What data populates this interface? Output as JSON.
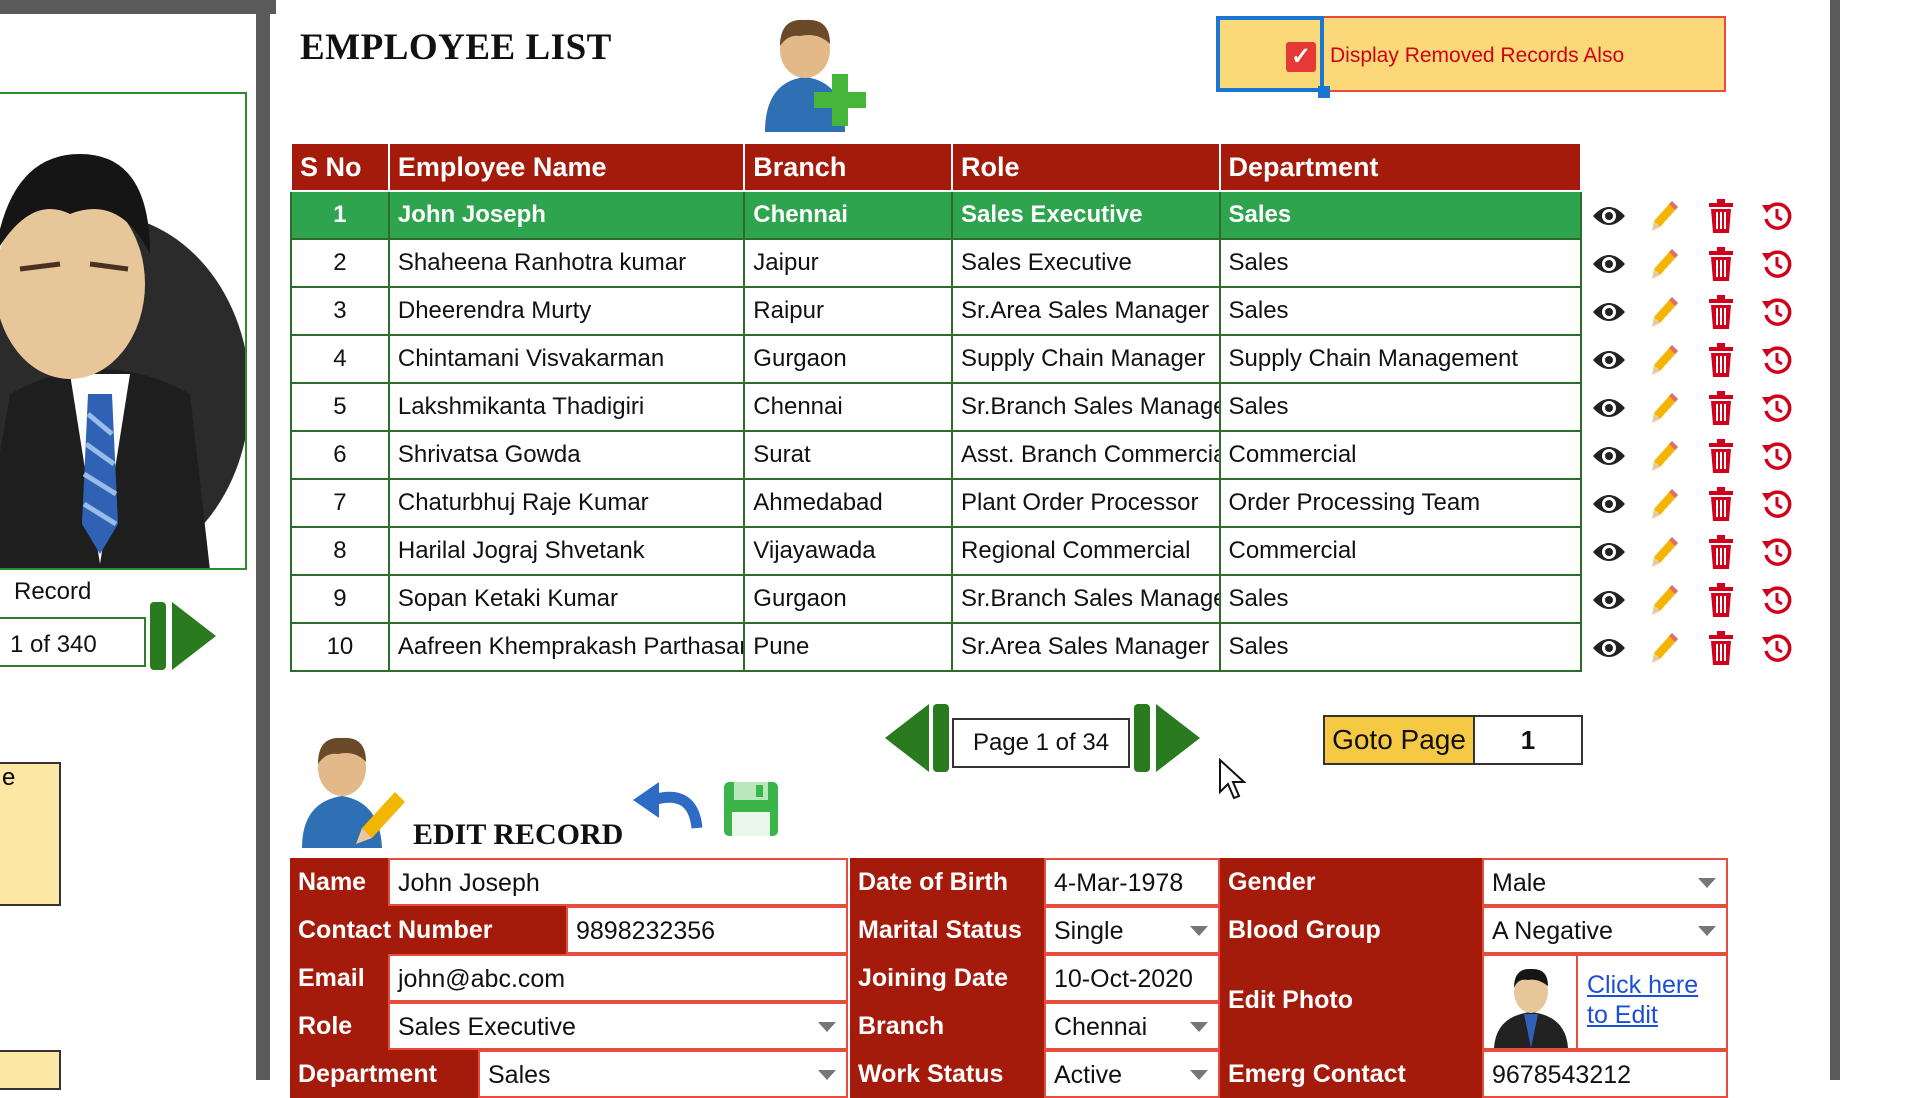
{
  "title": "EMPLOYEE LIST",
  "display_removed": {
    "label": "Display Removed Records Also",
    "checked": true
  },
  "left_panel": {
    "record_label": "Record",
    "record_value": "1 of 340",
    "note_letter": "e"
  },
  "table": {
    "headers": [
      "S No",
      "Employee Name",
      "Branch",
      "Role",
      "Department"
    ],
    "rows": [
      [
        "1",
        "John Joseph",
        "Chennai",
        "Sales Executive",
        "Sales"
      ],
      [
        "2",
        "Shaheena Ranhotra kumar",
        "Jaipur",
        "Sales Executive",
        "Sales"
      ],
      [
        "3",
        "Dheerendra Murty",
        "Raipur",
        "Sr.Area Sales Manager",
        "Sales"
      ],
      [
        "4",
        "Chintamani Visvakarman",
        "Gurgaon",
        "Supply Chain Manager",
        "Supply Chain Management"
      ],
      [
        "5",
        "Lakshmikanta Thadigiri",
        "Chennai",
        "Sr.Branch Sales Manager",
        "Sales"
      ],
      [
        "6",
        "Shrivatsa Gowda",
        "Surat",
        "Asst. Branch Commercial",
        "Commercial"
      ],
      [
        "7",
        "Chaturbhuj Raje Kumar",
        "Ahmedabad",
        "Plant Order Processor",
        "Order Processing Team"
      ],
      [
        "8",
        "Harilal Jograj Shvetank",
        "Vijayawada",
        "Regional Commercial",
        "Commercial"
      ],
      [
        "9",
        "Sopan Ketaki Kumar",
        "Gurgaon",
        "Sr.Branch Sales Manager",
        "Sales"
      ],
      [
        "10",
        "Aafreen Khemprakash Parthasarathy",
        "Pune",
        "Sr.Area Sales Manager",
        "Sales"
      ]
    ],
    "selected_row": 0
  },
  "row_actions": [
    "eye-icon",
    "pencil-icon",
    "trash-icon",
    "restore-icon"
  ],
  "pager": {
    "page_text": "Page 1 of 34",
    "goto_label": "Goto Page",
    "goto_value": "1"
  },
  "edit": {
    "title": "EDIT RECORD",
    "fields": {
      "name": {
        "label": "Name",
        "value": "John Joseph"
      },
      "contact": {
        "label": "Contact Number",
        "value": "9898232356"
      },
      "email": {
        "label": "Email",
        "value": "john@abc.com"
      },
      "role": {
        "label": "Role",
        "value": "Sales Executive"
      },
      "department": {
        "label": "Department",
        "value": "Sales"
      },
      "dob": {
        "label": "Date of Birth",
        "value": "4-Mar-1978"
      },
      "marital": {
        "label": "Marital Status",
        "value": "Single"
      },
      "joining": {
        "label": "Joining Date",
        "value": "10-Oct-2020"
      },
      "branch": {
        "label": "Branch",
        "value": "Chennai"
      },
      "work_status": {
        "label": "Work Status",
        "value": "Active"
      },
      "gender": {
        "label": "Gender",
        "value": "Male"
      },
      "blood": {
        "label": "Blood Group",
        "value": "A Negative"
      },
      "photo": {
        "label": "Edit Photo",
        "link": "Click here to Edit"
      },
      "emergency": {
        "label": "Emerg Contact",
        "value": "9678543212"
      }
    }
  },
  "colors": {
    "header_red": "#a51b0b",
    "selected_green": "#2ea44f",
    "nav_green": "#2a7a1f",
    "accent_yellow": "#fbd978"
  }
}
